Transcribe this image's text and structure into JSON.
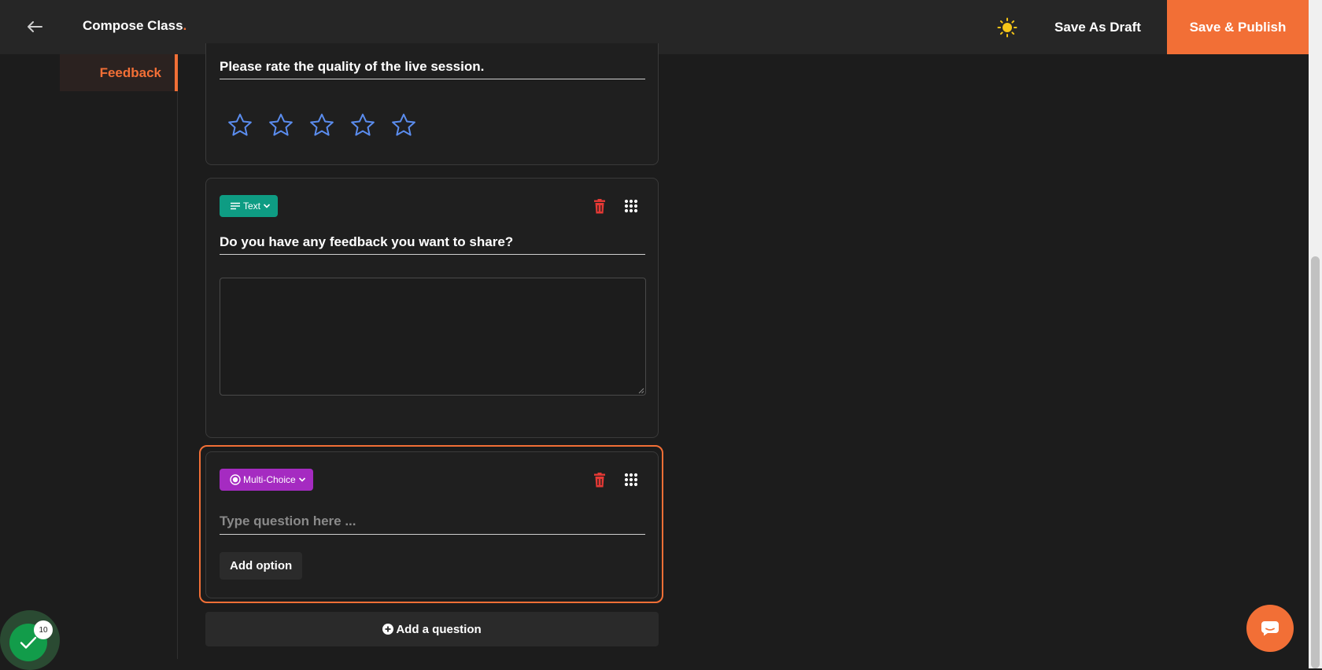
{
  "header": {
    "title": "Compose Class",
    "title_dot": ".",
    "save_draft_label": "Save As Draft",
    "publish_label": "Save & Publish"
  },
  "sidebar": {
    "active_item": "Feedback"
  },
  "questions": [
    {
      "type": "Rating",
      "text": "Please rate the quality of the live session.",
      "star_count": 5,
      "rating_value": 0
    },
    {
      "type": "Text",
      "text": "Do you have any feedback you want to share?",
      "answer_value": ""
    },
    {
      "type": "Multi-Choice",
      "text": "",
      "placeholder": "Type question here ...",
      "add_option_label": "Add option"
    }
  ],
  "add_question_label": "Add a question",
  "progress_badge": "10",
  "colors": {
    "accent": "#f26f36",
    "text_badge": "#0e9c83",
    "mc_badge": "#a52bc1",
    "star": "#5b8def",
    "delete": "#e53935"
  }
}
